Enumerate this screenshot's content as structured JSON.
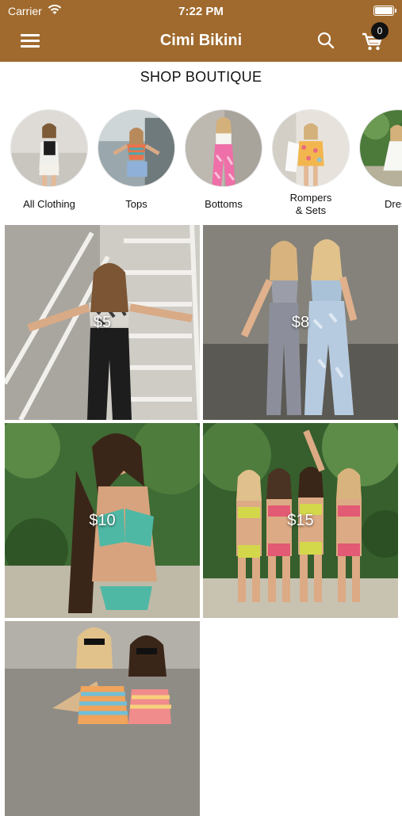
{
  "status_bar": {
    "carrier": "Carrier",
    "time": "7:22 PM"
  },
  "header": {
    "title": "Cimi Bikini",
    "cart_count": "0"
  },
  "section_title": "SHOP BOUTIQUE",
  "categories": [
    {
      "label": "All Clothing"
    },
    {
      "label": "Tops"
    },
    {
      "label": "Bottoms"
    },
    {
      "label": "Rompers & Sets",
      "line1": "Rompers",
      "line2": "& Sets"
    },
    {
      "label": "Dress"
    }
  ],
  "products": [
    {
      "price": "$5"
    },
    {
      "price": "$8"
    },
    {
      "price": "$10"
    },
    {
      "price": "$15"
    },
    {
      "price": ""
    }
  ],
  "colors": {
    "header_bg": "#a06a2e"
  },
  "icons": [
    "wifi-icon",
    "battery-icon",
    "menu-icon",
    "search-icon",
    "cart-icon"
  ]
}
